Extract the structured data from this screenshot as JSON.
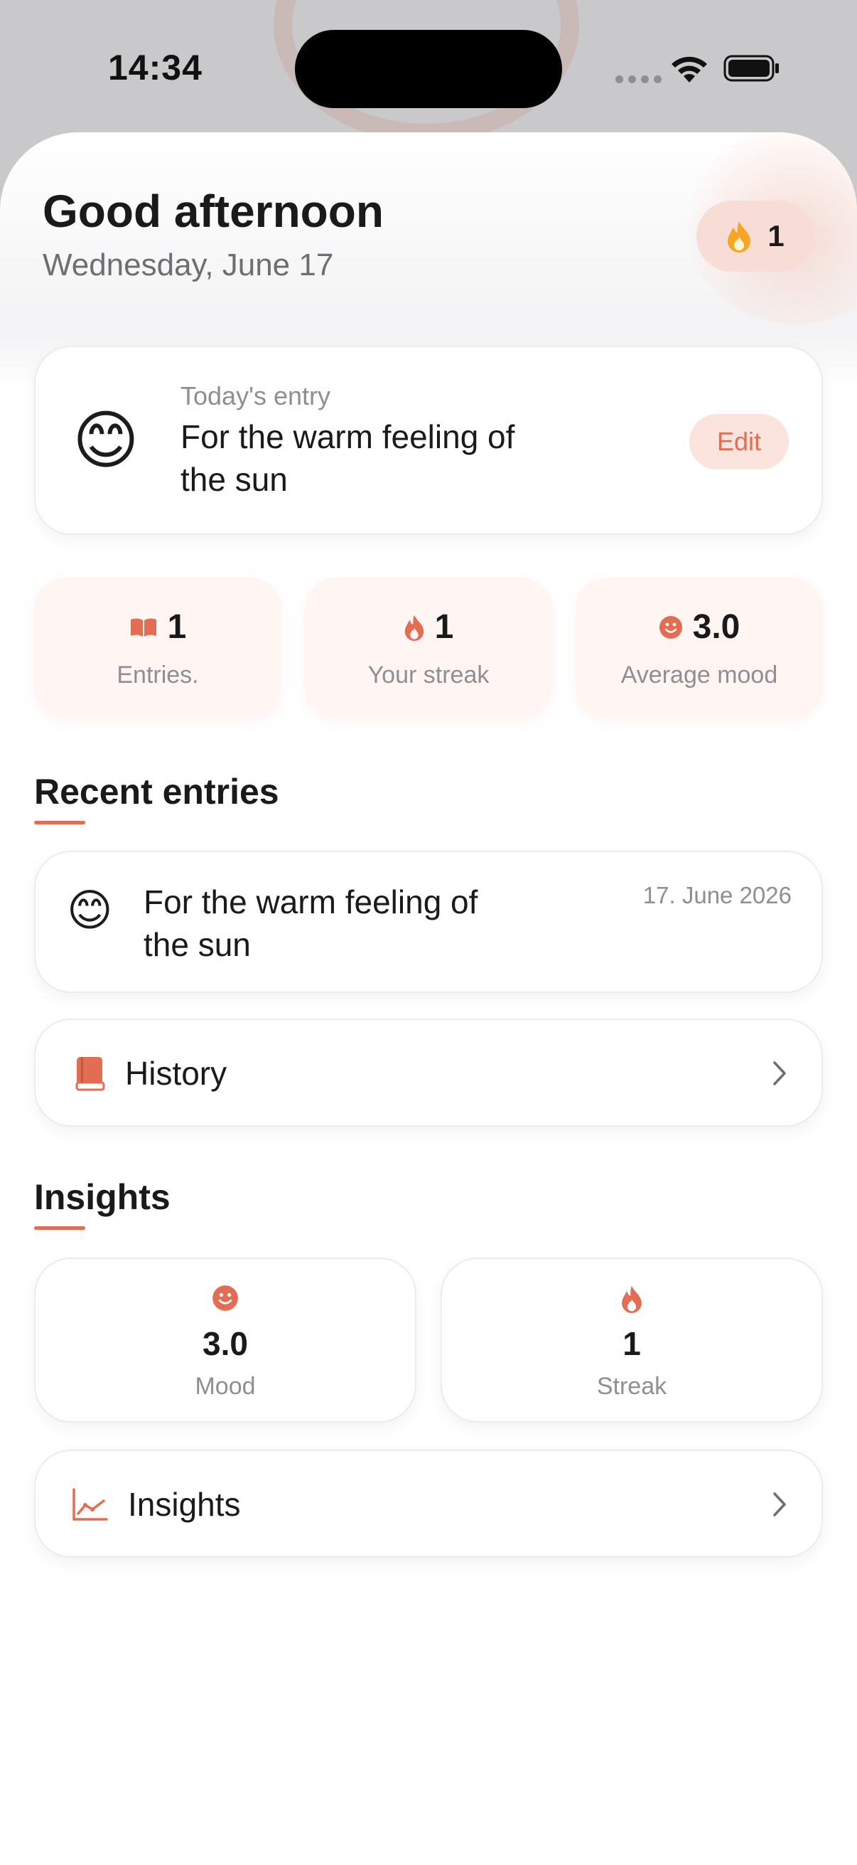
{
  "status_bar": {
    "time": "14:34"
  },
  "header": {
    "greeting": "Good afternoon",
    "date": "Wednesday, June 17",
    "streak_count": "1"
  },
  "today_entry": {
    "label": "Today's entry",
    "emoji": "😊",
    "text": "For the warm feeling of the sun",
    "edit_label": "Edit"
  },
  "stats": [
    {
      "icon": "book-icon",
      "value": "1",
      "label": "Entries."
    },
    {
      "icon": "flame-icon",
      "value": "1",
      "label": "Your streak"
    },
    {
      "icon": "smiley-icon",
      "value": "3.0",
      "label": "Average mood"
    }
  ],
  "recent": {
    "title": "Recent entries",
    "entries": [
      {
        "emoji": "😊",
        "text": "For the warm feeling of the sun",
        "date": "17. June 2026"
      }
    ],
    "history_label": "History"
  },
  "insights": {
    "title": "Insights",
    "cards": [
      {
        "icon": "smiley-icon",
        "value": "3.0",
        "label": "Mood"
      },
      {
        "icon": "flame-icon",
        "value": "1",
        "label": "Streak"
      }
    ],
    "link_label": "Insights"
  },
  "colors": {
    "accent": "#e36d52",
    "accent_soft": "#fbe4de",
    "flame_orange": "#f5a623"
  }
}
